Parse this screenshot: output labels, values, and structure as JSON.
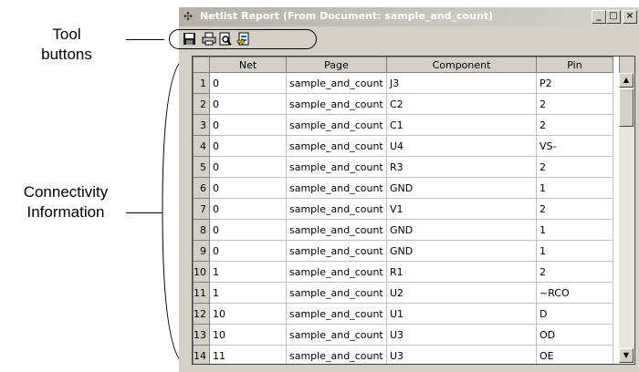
{
  "callouts": {
    "tool_buttons": "Tool\nbuttons",
    "connectivity": "Connectivity\nInformation"
  },
  "window": {
    "title": "Netlist Report (From Document: sample_and_count)",
    "controls": {
      "minimize": "_",
      "maximize": "□",
      "close": "×"
    }
  },
  "toolbar": {
    "buttons": [
      {
        "name": "save",
        "icon": "floppy-disk-icon"
      },
      {
        "name": "print",
        "icon": "printer-icon"
      },
      {
        "name": "print-preview",
        "icon": "preview-icon"
      },
      {
        "name": "export",
        "icon": "export-icon"
      }
    ]
  },
  "table": {
    "columns": [
      "Net",
      "Page",
      "Component",
      "Pin"
    ],
    "rows": [
      {
        "n": "1",
        "net": "0",
        "page": "sample_and_count",
        "component": "J3",
        "pin": "P2"
      },
      {
        "n": "2",
        "net": "0",
        "page": "sample_and_count",
        "component": "C2",
        "pin": "2"
      },
      {
        "n": "3",
        "net": "0",
        "page": "sample_and_count",
        "component": "C1",
        "pin": "2"
      },
      {
        "n": "4",
        "net": "0",
        "page": "sample_and_count",
        "component": "U4",
        "pin": "VS-"
      },
      {
        "n": "5",
        "net": "0",
        "page": "sample_and_count",
        "component": "R3",
        "pin": "2"
      },
      {
        "n": "6",
        "net": "0",
        "page": "sample_and_count",
        "component": "GND",
        "pin": "1"
      },
      {
        "n": "7",
        "net": "0",
        "page": "sample_and_count",
        "component": "V1",
        "pin": "2"
      },
      {
        "n": "8",
        "net": "0",
        "page": "sample_and_count",
        "component": "GND",
        "pin": "1"
      },
      {
        "n": "9",
        "net": "0",
        "page": "sample_and_count",
        "component": "GND",
        "pin": "1"
      },
      {
        "n": "10",
        "net": "1",
        "page": "sample_and_count",
        "component": "R1",
        "pin": "2"
      },
      {
        "n": "11",
        "net": "1",
        "page": "sample_and_count",
        "component": "U2",
        "pin": "~RCO"
      },
      {
        "n": "12",
        "net": "10",
        "page": "sample_and_count",
        "component": "U1",
        "pin": "D"
      },
      {
        "n": "13",
        "net": "10",
        "page": "sample_and_count",
        "component": "U3",
        "pin": "OD"
      },
      {
        "n": "14",
        "net": "11",
        "page": "sample_and_count",
        "component": "U3",
        "pin": "OE"
      }
    ]
  },
  "scrollbar": {
    "up": "▲",
    "down": "▼"
  }
}
